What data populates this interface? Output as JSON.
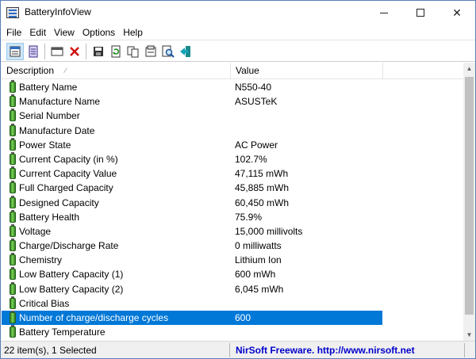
{
  "window": {
    "title": "BatteryInfoView"
  },
  "menu": [
    "File",
    "Edit",
    "View",
    "Options",
    "Help"
  ],
  "toolbar": {
    "icons": [
      "properties-icon",
      "html-report-icon",
      "window-icon",
      "delete-icon",
      "save-icon",
      "refresh-icon",
      "copy-icon",
      "properties-dialog-icon",
      "find-icon",
      "exit-icon"
    ]
  },
  "columns": {
    "description": "Description",
    "value": "Value"
  },
  "rows": [
    {
      "desc": "Battery Name",
      "value": "N550-40"
    },
    {
      "desc": "Manufacture Name",
      "value": "ASUSTeK"
    },
    {
      "desc": "Serial Number",
      "value": ""
    },
    {
      "desc": "Manufacture Date",
      "value": ""
    },
    {
      "desc": "Power State",
      "value": "AC Power"
    },
    {
      "desc": "Current Capacity (in %)",
      "value": "102.7%"
    },
    {
      "desc": "Current Capacity Value",
      "value": "47,115 mWh"
    },
    {
      "desc": "Full Charged Capacity",
      "value": "45,885 mWh"
    },
    {
      "desc": "Designed Capacity",
      "value": "60,450 mWh"
    },
    {
      "desc": "Battery Health",
      "value": "75.9%"
    },
    {
      "desc": "Voltage",
      "value": "15,000 millivolts"
    },
    {
      "desc": "Charge/Discharge Rate",
      "value": "0 milliwatts"
    },
    {
      "desc": "Chemistry",
      "value": "Lithium Ion"
    },
    {
      "desc": "Low Battery Capacity (1)",
      "value": "600 mWh"
    },
    {
      "desc": "Low Battery Capacity (2)",
      "value": "6,045 mWh"
    },
    {
      "desc": "Critical Bias",
      "value": ""
    },
    {
      "desc": "Number of charge/discharge cycles",
      "value": "600",
      "selected": true
    },
    {
      "desc": "Battery Temperature",
      "value": ""
    }
  ],
  "status": {
    "items": "22 item(s), 1 Selected",
    "credit": "NirSoft Freeware.  http://www.nirsoft.net"
  },
  "colors": {
    "selection": "#0078d7",
    "battery": "#3fa52a",
    "link": "#0000cc"
  }
}
